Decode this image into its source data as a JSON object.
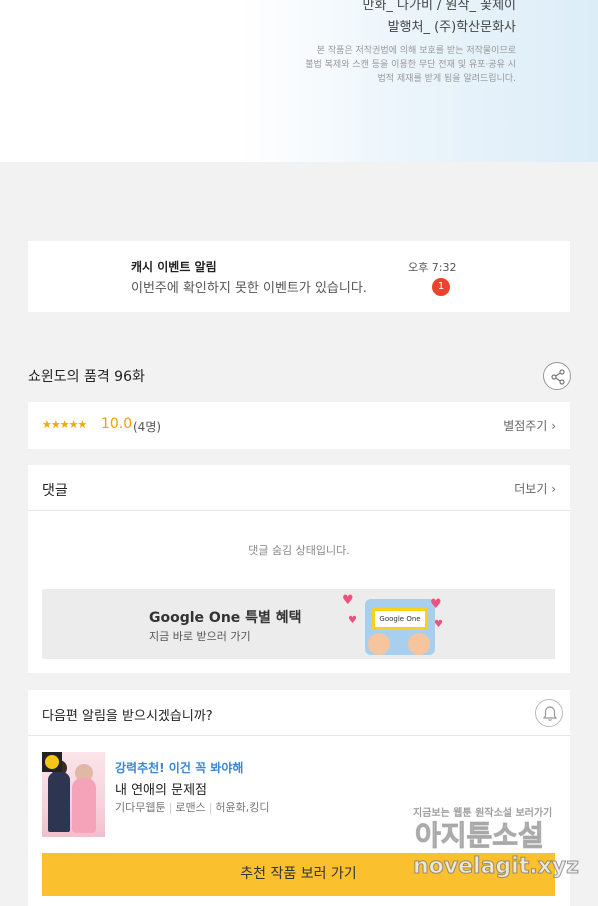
{
  "header": {
    "credits_art": "만화_ 나가비 / 원작_ 꽃제이",
    "publisher": "발행처_ (주)학산문화사",
    "notice_lines": [
      "본 작품은 저작권법에 의해 보호를 받는 저작물이므로",
      "불법 복제와 스캔 등을 이용한 무단 전재 및 유포·공유 시",
      "법적 제재를 받게 됨을 알려드립니다."
    ]
  },
  "notification": {
    "title": "캐시 이벤트 알림",
    "body": "이번주에 확인하지 못한 이벤트가 있습니다.",
    "time": "오후 7:32",
    "badge": "1"
  },
  "episode": {
    "title": "쇼윈도의 품격 96화",
    "share_icon": "share-icon"
  },
  "rating": {
    "stars": "★★★★★",
    "score": "10.0",
    "count": "(4명)",
    "rate_label": "별점주기"
  },
  "comments": {
    "header": "댓글",
    "more_label": "더보기",
    "hidden_message": "댓글 숨김 상태입니다."
  },
  "ad": {
    "title": "Google One 특별 혜택",
    "subtitle": "지금 바로 받으러 가기",
    "screen_text": "Google One"
  },
  "next_episode": {
    "question": "다음편 알림을 받으시겠습니까?",
    "recommend_tag": "강력추천! 이건 꼭 봐야해",
    "work_title": "내 연애의 문제점",
    "genre": "기다무웹툰",
    "category": "로맨스",
    "authors": "허윤화,킹디",
    "cta_label": "추천 작품 보러 가기"
  },
  "watermark": {
    "line1": "지금보는 웹툰 원작소설 보러가기",
    "line2": "아지툰소설",
    "line3": "novelagit.xyz"
  },
  "colors": {
    "accent_yellow": "#fbc02d",
    "badge_red": "#e8442e",
    "star_orange": "#f2a900",
    "link_blue": "#3a86d6",
    "page_bg": "#f2f2f2"
  }
}
